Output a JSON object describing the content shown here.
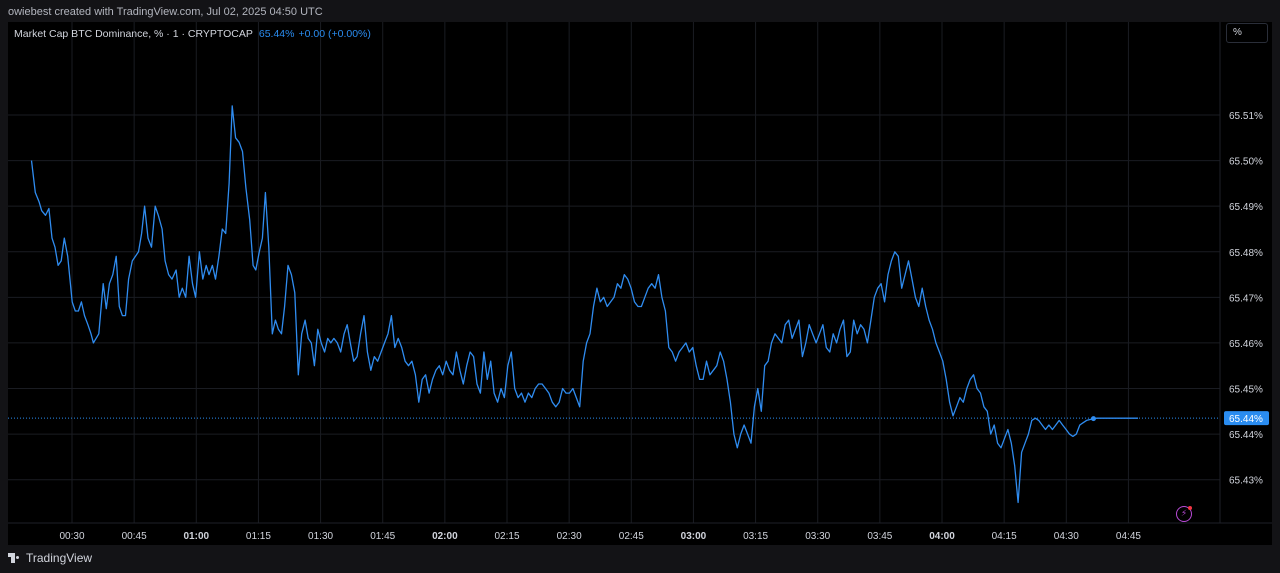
{
  "header": {
    "credit": "owiebest created with TradingView.com, Jul 02, 2025 04:50 UTC"
  },
  "legend": {
    "symbol": "Market Cap BTC Dominance, % · 1 · CRYPTOCAP",
    "price": "65.44%",
    "change": "+0.00 (+0.00%)"
  },
  "unit_label": "%",
  "footer": {
    "brand": "TradingView"
  },
  "colors": {
    "line": "#2f8cf0",
    "badge": "#2a8cf0",
    "grid": "#1a1c22",
    "axis_text": "#d1d4dc",
    "background": "#000000"
  },
  "chart_data": {
    "type": "line",
    "title": "Market Cap BTC Dominance, % · 1 · CRYPTOCAP",
    "xlabel": "",
    "ylabel": "%",
    "ylim": [
      65.4205,
      65.5304
    ],
    "xlim": [
      0.5,
      4.885
    ],
    "grid": true,
    "y_ticks": [
      {
        "value": 65.43,
        "label": "65.43%"
      },
      {
        "value": 65.44,
        "label": "65.44%"
      },
      {
        "value": 65.45,
        "label": "65.45%"
      },
      {
        "value": 65.46,
        "label": "65.46%"
      },
      {
        "value": 65.47,
        "label": "65.47%"
      },
      {
        "value": 65.48,
        "label": "65.48%"
      },
      {
        "value": 65.49,
        "label": "65.49%"
      },
      {
        "value": 65.5,
        "label": "65.50%"
      },
      {
        "value": 65.51,
        "label": "65.51%"
      }
    ],
    "x_ticks": [
      {
        "value": 0.5,
        "label": "00:30",
        "bold": false
      },
      {
        "value": 0.75,
        "label": "00:45",
        "bold": false
      },
      {
        "value": 1.0,
        "label": "01:00",
        "bold": true
      },
      {
        "value": 1.25,
        "label": "01:15",
        "bold": false
      },
      {
        "value": 1.5,
        "label": "01:30",
        "bold": false
      },
      {
        "value": 1.75,
        "label": "01:45",
        "bold": false
      },
      {
        "value": 2.0,
        "label": "02:00",
        "bold": true
      },
      {
        "value": 2.25,
        "label": "02:15",
        "bold": false
      },
      {
        "value": 2.5,
        "label": "02:30",
        "bold": false
      },
      {
        "value": 2.75,
        "label": "02:45",
        "bold": false
      },
      {
        "value": 3.0,
        "label": "03:00",
        "bold": true
      },
      {
        "value": 3.25,
        "label": "03:15",
        "bold": false
      },
      {
        "value": 3.5,
        "label": "03:30",
        "bold": false
      },
      {
        "value": 3.75,
        "label": "03:45",
        "bold": false
      },
      {
        "value": 4.0,
        "label": "04:00",
        "bold": true
      },
      {
        "value": 4.25,
        "label": "04:15",
        "bold": false
      },
      {
        "value": 4.5,
        "label": "04:30",
        "bold": false
      },
      {
        "value": 4.75,
        "label": "04:45",
        "bold": false
      }
    ],
    "last_value": {
      "value": 65.4435,
      "label": "65.44%"
    },
    "series": [
      {
        "x": [
          0.3372,
          0.3523,
          0.3674,
          0.3783,
          0.3934,
          0.4071,
          0.4195,
          0.4318,
          0.4442,
          0.4566,
          0.469,
          0.4829,
          0.5008,
          0.5132,
          0.5256,
          0.538,
          0.5503,
          0.5641,
          0.5765,
          0.5861,
          0.6078,
          0.6256,
          0.638,
          0.6504,
          0.6641,
          0.6779,
          0.6903,
          0.7027,
          0.7151,
          0.7275,
          0.7426,
          0.7674,
          0.7798,
          0.7921,
          0.8059,
          0.8197,
          0.8349,
          0.8472,
          0.8624,
          0.8747,
          0.8885,
          0.9023,
          0.9188,
          0.9312,
          0.9436,
          0.9573,
          0.9711,
          0.9849,
          0.9973,
          1.0124,
          1.0262,
          1.04,
          1.051,
          1.0647,
          1.0771,
          1.0909,
          1.1047,
          1.1184,
          1.1322,
          1.1446,
          1.1583,
          1.1721,
          1.1859,
          1.1997,
          1.2148,
          1.2286,
          1.2396,
          1.2534,
          1.2658,
          1.2782,
          1.2919,
          1.3057,
          1.3181,
          1.3304,
          1.3428,
          1.3552,
          1.369,
          1.3828,
          1.3965,
          1.4103,
          1.4241,
          1.4379,
          1.4502,
          1.4626,
          1.475,
          1.4888,
          1.5026,
          1.5163,
          1.5287,
          1.5411,
          1.5535,
          1.5673,
          1.581,
          1.5948,
          1.6072,
          1.6196,
          1.6333,
          1.6471,
          1.6609,
          1.6747,
          1.6884,
          1.7022,
          1.716,
          1.7298,
          1.7436,
          1.7573,
          1.7711,
          1.7849,
          1.7986,
          1.8124,
          1.8262,
          1.84,
          1.8538,
          1.8675,
          1.8813,
          1.8951,
          1.9089,
          1.9226,
          1.9364,
          1.9502,
          1.964,
          1.9777,
          1.9915,
          2.0053,
          2.0191,
          2.0329,
          2.0466,
          2.0604,
          2.0742,
          2.088,
          2.1017,
          2.1155,
          2.1293,
          2.1431,
          2.1569,
          2.1706,
          2.1844,
          2.1982,
          2.212,
          2.2257,
          2.2395,
          2.2533,
          2.2671,
          2.2809,
          2.2946,
          2.3084,
          2.3222,
          2.336,
          2.3497,
          2.3635,
          2.3773,
          2.3911,
          2.4049,
          2.4186,
          2.4324,
          2.4462,
          2.46,
          2.4738,
          2.4875,
          2.5013,
          2.5151,
          2.5289,
          2.5426,
          2.5564,
          2.5702,
          2.584,
          2.5978,
          2.6115,
          2.6253,
          2.6391,
          2.6529,
          2.6666,
          2.6804,
          2.6942,
          2.708,
          2.7218,
          2.7355,
          2.7493,
          2.7631,
          2.7769,
          2.7906,
          2.8044,
          2.8182,
          2.832,
          2.8458,
          2.8595,
          2.8733,
          2.8871,
          2.9009,
          2.9146,
          2.9284,
          2.9422,
          2.956,
          2.9698,
          2.9835,
          2.9973,
          3.0111,
          3.0249,
          3.0387,
          3.0524,
          3.0662,
          3.08,
          3.0938,
          3.1075,
          3.1213,
          3.1351,
          3.1489,
          3.1627,
          3.1764,
          3.1902,
          3.204,
          3.2178,
          3.2315,
          3.2453,
          3.2591,
          3.2729,
          3.2867,
          3.3004,
          3.3142,
          3.328,
          3.3418,
          3.3555,
          3.3693,
          3.3831,
          3.3969,
          3.4107,
          3.4244,
          3.4382,
          3.452,
          3.4658,
          3.4795,
          3.4933,
          3.5071,
          3.5209,
          3.5347,
          3.5484,
          3.5622,
          3.576,
          3.5898,
          3.6035,
          3.6173,
          3.6311,
          3.6449,
          3.6587,
          3.6724,
          3.6862,
          3.7,
          3.7138,
          3.7276,
          3.7413,
          3.7551,
          3.7689,
          3.7827,
          3.7964,
          3.8102,
          3.824,
          3.8378,
          3.8516,
          3.8653,
          3.8791,
          3.8929,
          3.9067,
          3.9204,
          3.9342,
          3.948,
          3.9618,
          3.9756,
          3.9893,
          4.0031,
          4.0169,
          4.0307,
          4.0444,
          4.0582,
          4.072,
          4.0858,
          4.0996,
          4.1133,
          4.1271,
          4.1409,
          4.1547,
          4.1684,
          4.1822,
          4.196,
          4.2098,
          4.2236,
          4.2373,
          4.2511,
          4.2649,
          4.2787,
          4.2924,
          4.3062,
          4.32,
          4.3338,
          4.3476,
          4.3613,
          4.3751,
          4.3889,
          4.4027,
          4.4164,
          4.4302,
          4.444,
          4.4578,
          4.4716,
          4.4853,
          4.4991,
          4.5129,
          4.5267,
          4.5404,
          4.5542,
          4.568,
          4.5818,
          4.5956,
          4.6093,
          4.6231,
          4.6369,
          4.6507,
          4.6644,
          4.6782,
          4.692,
          4.7058,
          4.7196,
          4.7333,
          4.7471,
          4.7609,
          4.7747,
          4.7885
        ],
        "y": [
          65.5,
          65.493,
          65.491,
          65.489,
          65.488,
          65.4895,
          65.483,
          65.481,
          65.477,
          65.478,
          65.483,
          65.479,
          65.469,
          65.467,
          65.467,
          65.469,
          65.466,
          65.464,
          65.462,
          65.46,
          65.462,
          65.473,
          65.4675,
          65.473,
          65.475,
          65.479,
          65.468,
          65.466,
          65.466,
          65.474,
          65.478,
          65.48,
          65.484,
          65.49,
          65.483,
          65.481,
          65.49,
          65.488,
          65.485,
          65.478,
          65.475,
          65.474,
          65.476,
          65.47,
          65.472,
          65.47,
          65.479,
          65.473,
          65.47,
          65.48,
          65.474,
          65.477,
          65.475,
          65.477,
          65.474,
          65.479,
          65.485,
          65.484,
          65.495,
          65.512,
          65.505,
          65.504,
          65.502,
          65.494,
          65.487,
          65.477,
          65.476,
          65.48,
          65.483,
          65.493,
          65.481,
          65.462,
          65.465,
          65.463,
          65.462,
          65.468,
          65.477,
          65.475,
          65.471,
          65.453,
          65.462,
          65.465,
          65.461,
          65.46,
          65.455,
          65.463,
          65.46,
          65.458,
          65.461,
          65.46,
          65.461,
          65.46,
          65.458,
          65.462,
          65.464,
          65.46,
          65.456,
          65.457,
          65.462,
          65.466,
          65.458,
          65.454,
          65.457,
          65.456,
          65.458,
          65.46,
          65.462,
          65.466,
          65.459,
          65.461,
          65.459,
          65.456,
          65.455,
          65.456,
          65.453,
          65.447,
          65.452,
          65.453,
          65.449,
          65.452,
          65.454,
          65.455,
          65.453,
          65.456,
          65.454,
          65.453,
          65.458,
          65.454,
          65.451,
          65.455,
          65.458,
          65.457,
          65.451,
          65.449,
          65.458,
          65.452,
          65.456,
          65.449,
          65.447,
          65.45,
          65.448,
          65.455,
          65.458,
          65.45,
          65.448,
          65.449,
          65.447,
          65.449,
          65.448,
          65.45,
          65.451,
          65.451,
          65.45,
          65.449,
          65.447,
          65.446,
          65.447,
          65.45,
          65.449,
          65.449,
          65.45,
          65.448,
          65.446,
          65.456,
          65.46,
          65.462,
          65.468,
          65.472,
          65.469,
          65.47,
          65.468,
          65.469,
          65.47,
          65.473,
          65.472,
          65.475,
          65.474,
          65.472,
          65.469,
          65.468,
          65.468,
          65.47,
          65.472,
          65.473,
          65.472,
          65.475,
          65.47,
          65.467,
          65.459,
          65.458,
          65.456,
          65.458,
          65.459,
          65.46,
          65.458,
          65.459,
          65.455,
          65.452,
          65.452,
          65.456,
          65.453,
          65.454,
          65.455,
          65.458,
          65.456,
          65.452,
          65.447,
          65.44,
          65.437,
          65.44,
          65.442,
          65.44,
          65.438,
          65.446,
          65.45,
          65.445,
          65.455,
          65.456,
          65.46,
          65.462,
          65.461,
          65.46,
          65.464,
          65.465,
          65.461,
          65.463,
          65.465,
          65.457,
          65.46,
          65.464,
          65.462,
          65.46,
          65.462,
          65.464,
          65.459,
          65.458,
          65.462,
          65.46,
          65.463,
          65.465,
          65.457,
          65.458,
          65.465,
          65.462,
          65.464,
          65.463,
          65.46,
          65.465,
          65.47,
          65.472,
          65.473,
          65.469,
          65.475,
          65.478,
          65.48,
          65.479,
          65.472,
          65.475,
          65.478,
          65.474,
          65.47,
          65.468,
          65.472,
          65.468,
          65.465,
          65.463,
          65.46,
          65.458,
          65.456,
          65.452,
          65.447,
          65.444,
          65.446,
          65.448,
          65.447,
          65.45,
          65.452,
          65.453,
          65.45,
          65.449,
          65.446,
          65.445,
          65.44,
          65.442,
          65.438,
          65.437,
          65.439,
          65.441,
          65.438,
          65.433,
          65.425,
          65.436,
          65.438,
          65.44,
          65.443,
          65.4435,
          65.443,
          65.442,
          65.441,
          65.442,
          65.441,
          65.442,
          65.443,
          65.442,
          65.441,
          65.44,
          65.4395,
          65.44,
          65.442,
          65.4425,
          65.443,
          65.4432,
          65.4434,
          65.4435,
          65.4435,
          65.4435,
          65.4435,
          65.4435,
          65.4435,
          65.4435,
          65.4435,
          65.4435,
          65.4435,
          65.4435,
          65.4435,
          65.4435
        ]
      }
    ]
  }
}
